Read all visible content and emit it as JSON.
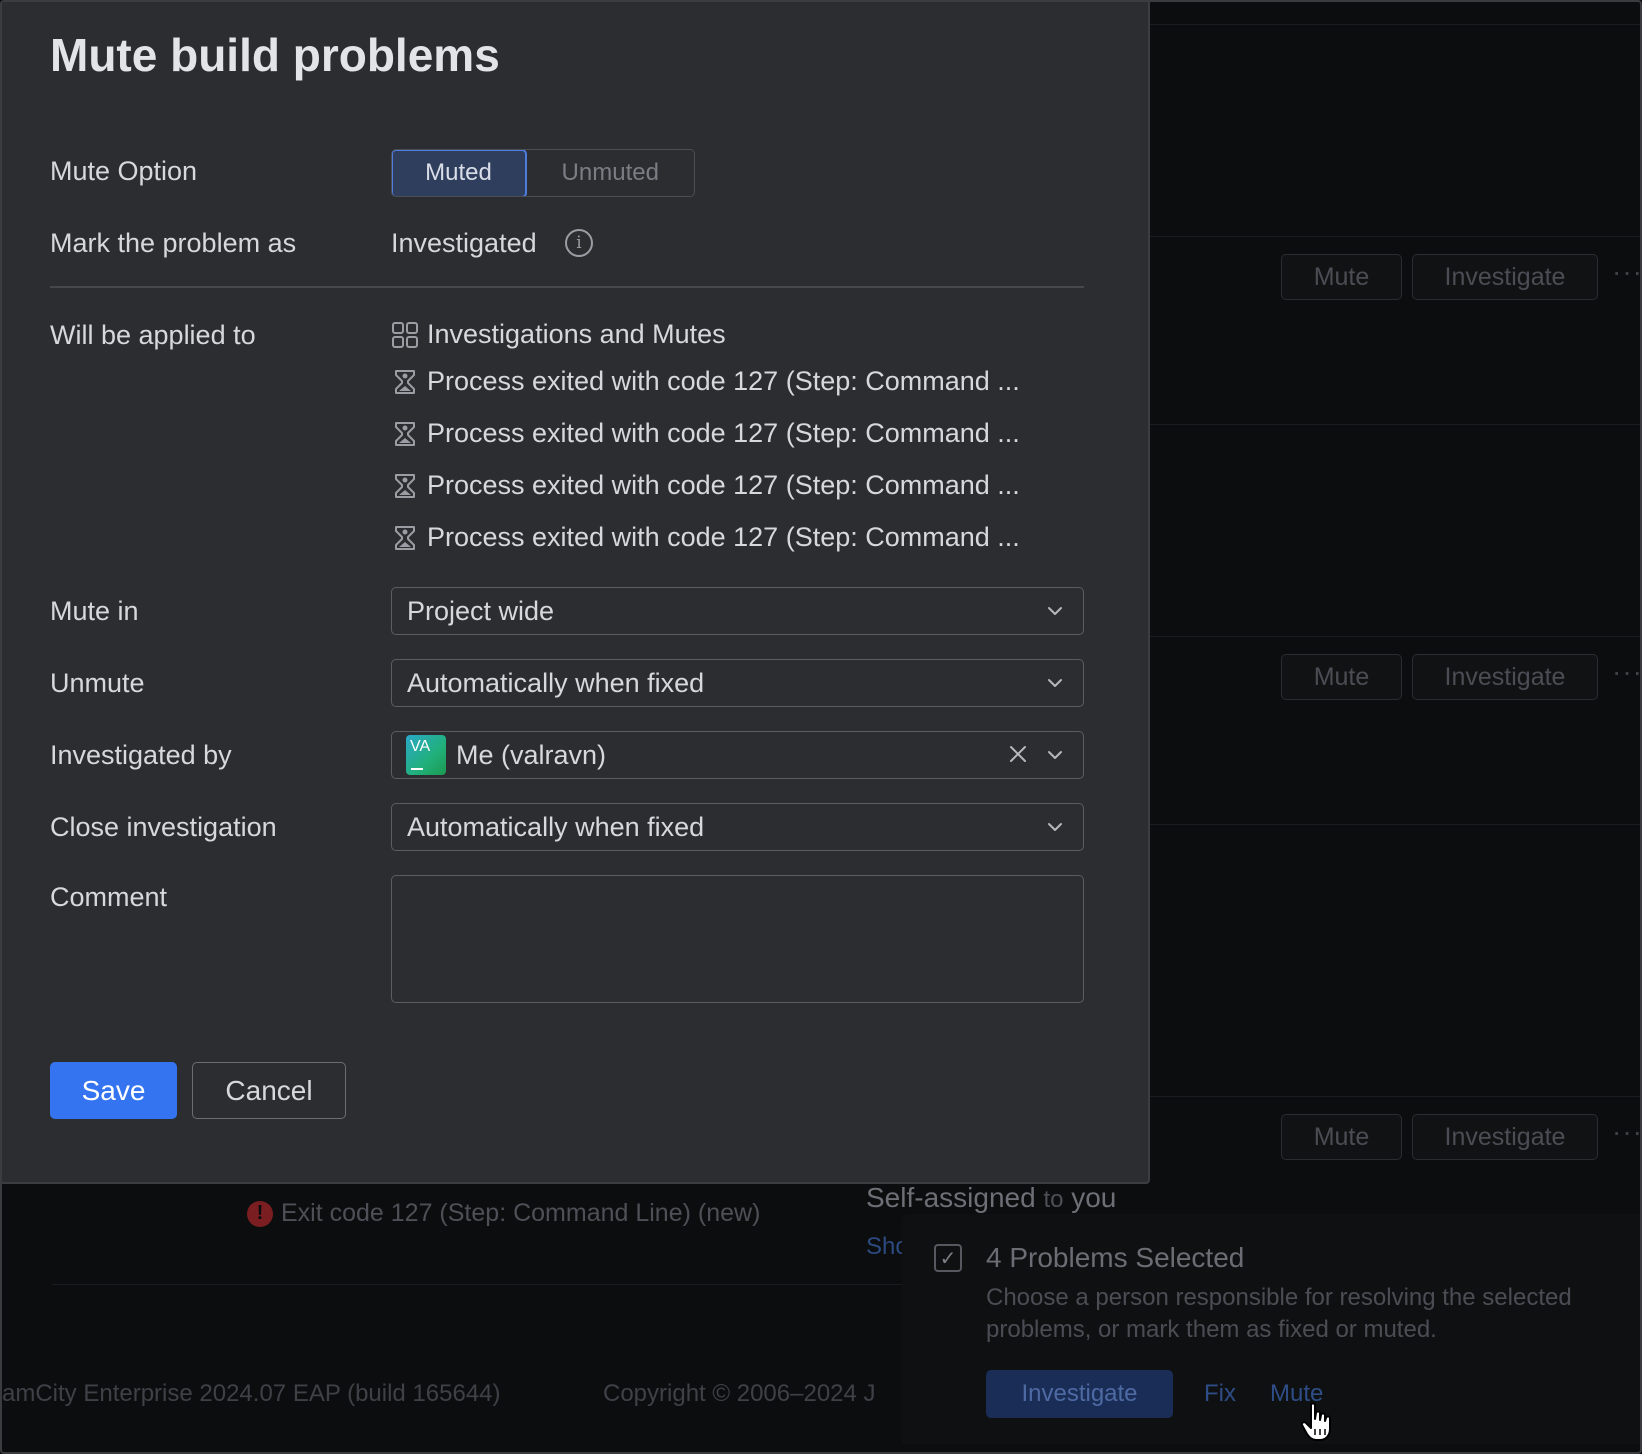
{
  "modal": {
    "title": "Mute build problems",
    "mute_option": {
      "label": "Mute Option",
      "options": [
        "Muted",
        "Unmuted"
      ],
      "selected": "Muted"
    },
    "mark_as": {
      "label": "Mark the problem as",
      "value": "Investigated"
    },
    "applied_to": {
      "label": "Will be applied to",
      "items": [
        {
          "icon": "grid-icon",
          "text": "Investigations and Mutes"
        },
        {
          "icon": "build-problem-icon",
          "text": "Process exited with code 127 (Step: Command ..."
        },
        {
          "icon": "build-problem-icon",
          "text": "Process exited with code 127 (Step: Command ..."
        },
        {
          "icon": "build-problem-icon",
          "text": "Process exited with code 127 (Step: Command ..."
        },
        {
          "icon": "build-problem-icon",
          "text": "Process exited with code 127 (Step: Command ..."
        }
      ]
    },
    "mute_in": {
      "label": "Mute in",
      "value": "Project wide"
    },
    "unmute": {
      "label": "Unmute",
      "value": "Automatically when fixed"
    },
    "investigated_by": {
      "label": "Investigated by",
      "value": "Me (valravn)",
      "avatar_initials": "VA"
    },
    "close_investigation": {
      "label": "Close investigation",
      "value": "Automatically when fixed"
    },
    "comment": {
      "label": "Comment",
      "value": ""
    },
    "save_label": "Save",
    "cancel_label": "Cancel"
  },
  "background": {
    "row_buttons": [
      {
        "mute": "Mute",
        "investigate": "Investigate",
        "more": "···"
      },
      {
        "mute": "Mute",
        "investigate": "Investigate",
        "more": "···"
      },
      {
        "mute": "Mute",
        "investigate": "Investigate",
        "more": "···"
      }
    ],
    "error_text": "Exit code 127 (Step: Command Line) (new)",
    "self_assigned": "Self-assigned",
    "self_assigned_to": "to",
    "self_assigned_you": "you",
    "show_link_partial": "Sho",
    "footer_version": "amCity Enterprise 2024.07 EAP (build 165644)",
    "footer_copyright": "Copyright © 2006–2024 J"
  },
  "selection_panel": {
    "title": "4 Problems Selected",
    "description": "Choose a person responsible for resolving the selected problems, or mark them as fixed or muted.",
    "investigate_label": "Investigate",
    "fix_label": "Fix",
    "mute_label": "Mute"
  },
  "colors": {
    "accent": "#3574f0",
    "modal_bg": "#2b2d31",
    "page_bg": "#0c0d0e",
    "selected_segment_border": "#4d7ddc"
  }
}
